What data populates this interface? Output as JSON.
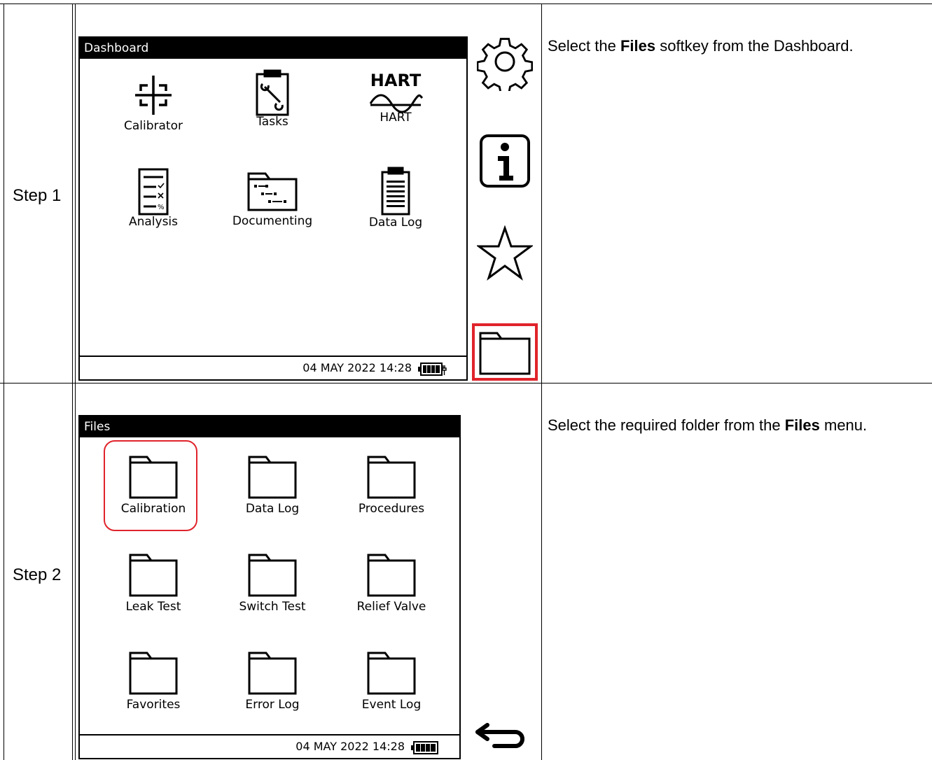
{
  "rows": [
    {
      "step": "Step 1",
      "description": {
        "before": "Select the ",
        "bold": "Files",
        "after": " softkey from the Dashboard."
      },
      "screen": {
        "title": "Dashboard",
        "items": [
          "Calibrator",
          "Tasks",
          "HART",
          "Analysis",
          "Documenting",
          "Data Log"
        ],
        "hart_logo": "HART",
        "status": "04 MAY 2022 14:28",
        "softkeys": [
          "gear-icon",
          "info-icon",
          "star-icon",
          "folder-icon"
        ],
        "selected_softkey": "folder-icon"
      }
    },
    {
      "step": "Step 2",
      "description": {
        "before": "Select the required folder from the ",
        "bold": "Files",
        "after": " menu."
      },
      "screen": {
        "title": "Files",
        "folders": [
          "Calibration",
          "Data Log",
          "Procedures",
          "Leak Test",
          "Switch Test",
          "Relief Valve",
          "Favorites",
          "Error Log",
          "Event Log"
        ],
        "selected_folder": "Calibration",
        "status": "04 MAY 2022 14:28",
        "softkeys": [
          "back-arrow-icon"
        ]
      }
    }
  ],
  "colors": {
    "highlight": "#e0232b",
    "titlebar": "#000000"
  }
}
